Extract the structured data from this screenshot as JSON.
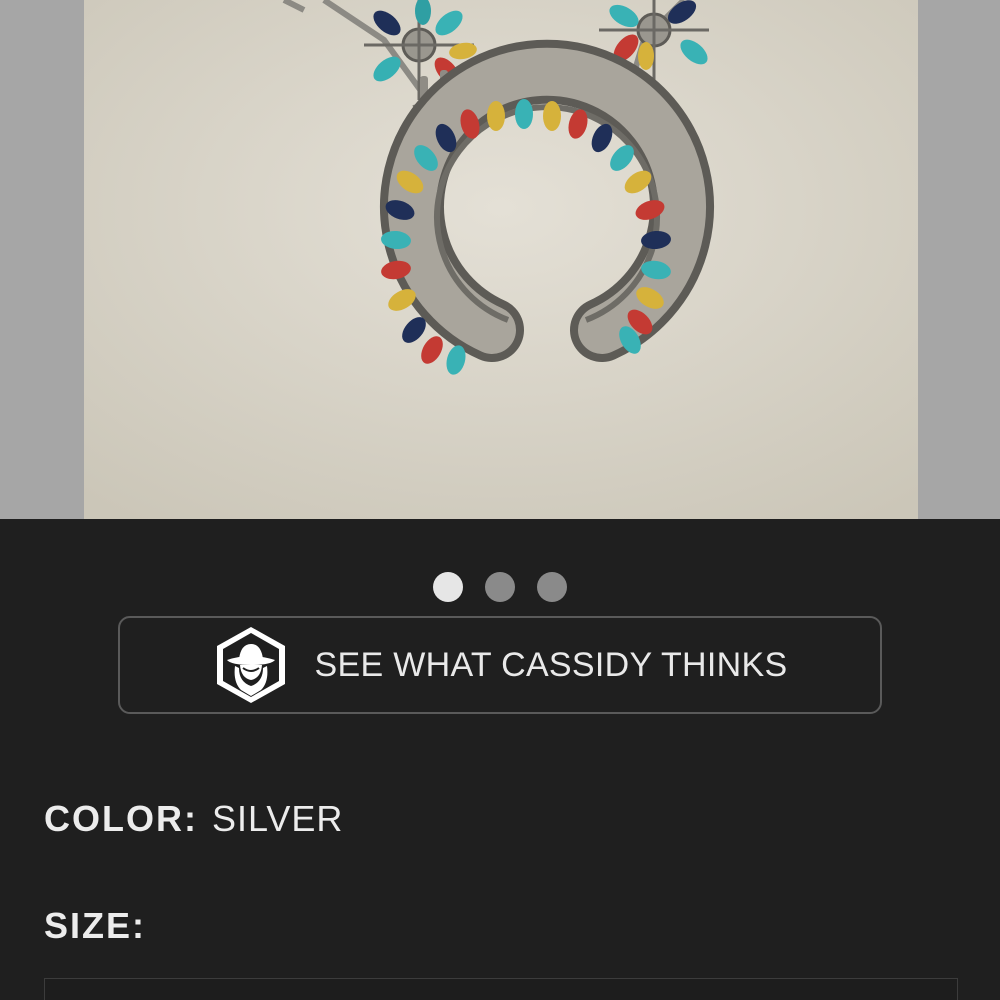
{
  "product": {
    "image": {
      "subject": "squash-blossom-necklace",
      "background_color": "#dcd8cc"
    }
  },
  "gallery": {
    "slides": [
      {
        "active": true
      },
      {
        "active": false
      },
      {
        "active": false
      }
    ]
  },
  "cassidy_button": {
    "label": "SEE WHAT CASSIDY THINKS",
    "icon": "cowgirl-hat-badge-icon"
  },
  "options": {
    "color": {
      "label": "COLOR:",
      "value": "SILVER"
    },
    "size": {
      "label": "SIZE:",
      "value": ""
    }
  },
  "colors": {
    "background": "#1f1f1f",
    "text": "#ececec",
    "dot_active": "#e6e6e6",
    "dot_inactive": "#8a8a8a",
    "border": "#5a5a5a"
  }
}
